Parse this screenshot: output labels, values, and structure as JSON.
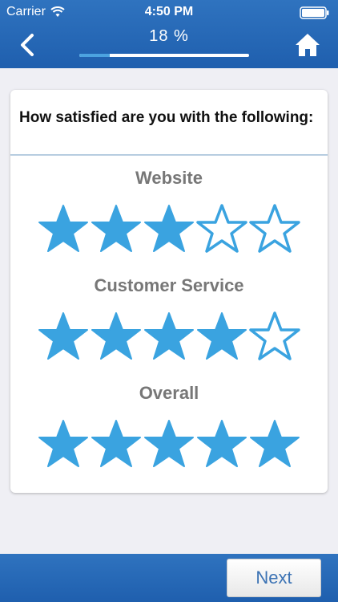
{
  "status_bar": {
    "carrier": "Carrier",
    "time": "4:50 PM"
  },
  "header": {
    "progress_text": "18 %",
    "progress_fraction": 0.18
  },
  "question": "How satisfied are you with the following:",
  "ratings": [
    {
      "label": "Website",
      "value": 3,
      "max": 5
    },
    {
      "label": "Customer Service",
      "value": 4,
      "max": 5
    },
    {
      "label": "Overall",
      "value": 5,
      "max": 5
    }
  ],
  "footer": {
    "next_label": "Next"
  },
  "colors": {
    "header_blue": "#2466b3",
    "star_blue": "#3aa3e0"
  }
}
